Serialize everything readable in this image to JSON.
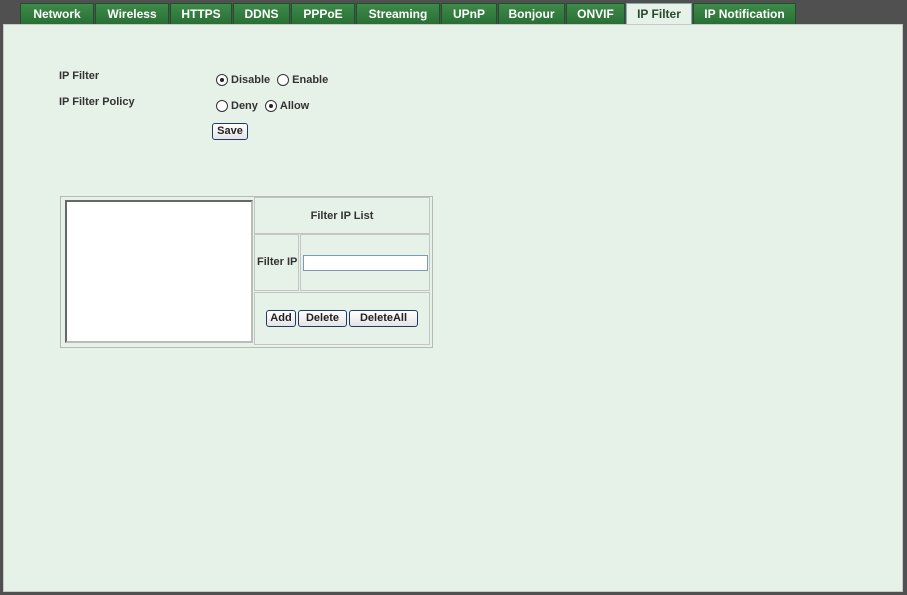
{
  "tabs": [
    {
      "label": "Network",
      "active": false
    },
    {
      "label": "Wireless",
      "active": false
    },
    {
      "label": "HTTPS",
      "active": false
    },
    {
      "label": "DDNS",
      "active": false
    },
    {
      "label": "PPPoE",
      "active": false
    },
    {
      "label": "Streaming",
      "active": false
    },
    {
      "label": "UPnP",
      "active": false
    },
    {
      "label": "Bonjour",
      "active": false
    },
    {
      "label": "ONVIF",
      "active": false
    },
    {
      "label": "IP Filter",
      "active": true
    },
    {
      "label": "IP Notification",
      "active": false
    }
  ],
  "settings": {
    "ip_filter_label": "IP Filter",
    "ip_filter_options": {
      "disable": "Disable",
      "enable": "Enable",
      "selected": "Disable"
    },
    "policy_label": "IP Filter Policy",
    "policy_options": {
      "deny": "Deny",
      "allow": "Allow",
      "selected": "Allow"
    },
    "save_label": "Save"
  },
  "filter_list": {
    "title": "Filter IP List",
    "ip_label": "Filter IP",
    "ip_value": "",
    "entries": [],
    "add_label": "Add",
    "delete_label": "Delete",
    "delete_all_label": "DeleteAll"
  },
  "colors": {
    "tab_green": "#2a6f35",
    "panel_bg": "#e6f1e8",
    "button_border": "#1e3a66"
  }
}
